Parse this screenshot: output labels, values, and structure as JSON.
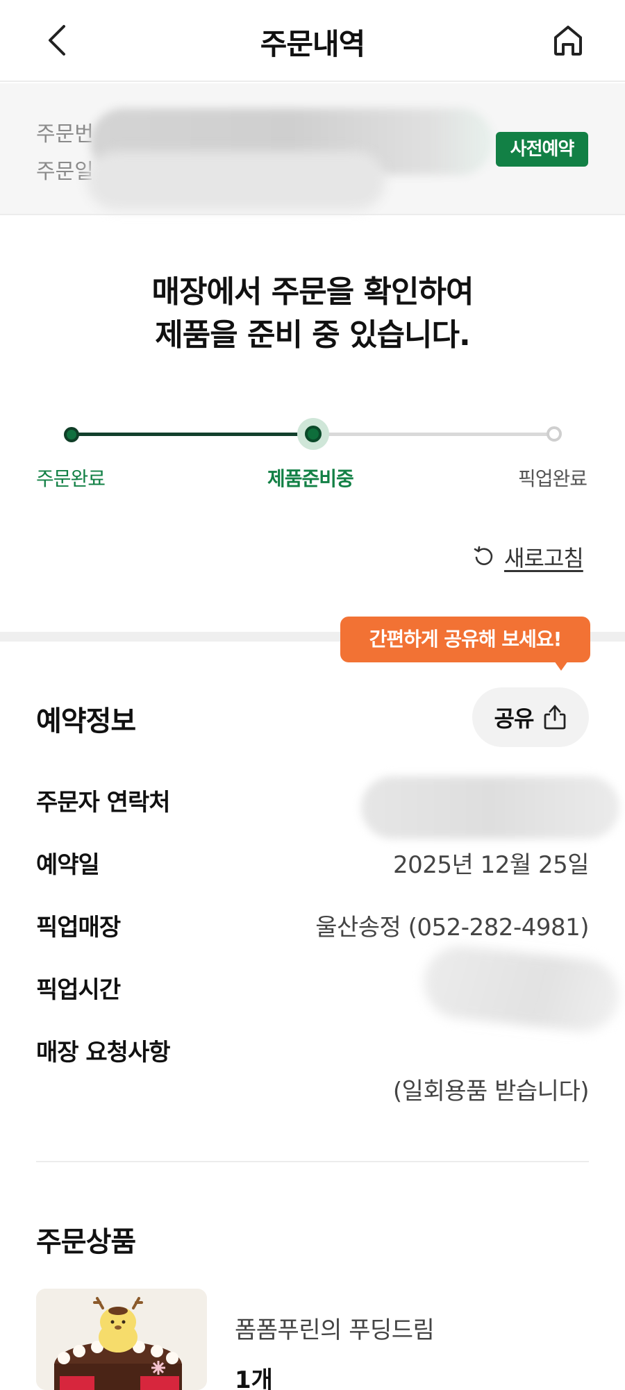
{
  "header": {
    "title": "주문내역",
    "back_icon": "chevron-left-icon",
    "home_icon": "home-icon"
  },
  "order_meta": {
    "order_number_label": "주문번",
    "order_date_label": "주문일",
    "badge": "사전예약",
    "badge_color": "#128045"
  },
  "status": {
    "message_line1": "매장에서 주문을 확인하여",
    "message_line2": "제품을 준비 중 있습니다.",
    "steps": [
      "주문완료",
      "제품준비중",
      "픽업완료"
    ],
    "current_step": 2,
    "accent_color": "#128045"
  },
  "refresh": {
    "label": "새로고침",
    "icon": "refresh-icon"
  },
  "tooltip": {
    "text": "간편하게 공유해 보세요!",
    "color": "#f27234"
  },
  "reservation": {
    "title": "예약정보",
    "share_label": "공유",
    "share_icon": "share-icon",
    "rows": [
      {
        "label": "주문자 연락처",
        "value": ""
      },
      {
        "label": "예약일",
        "value": "2025년 12월 25일"
      },
      {
        "label": "픽업매장",
        "value": "울산송정 (052-282-4981)"
      },
      {
        "label": "픽업시간",
        "value": ""
      },
      {
        "label": "매장 요청사항",
        "value": "(일회용품 받습니다)"
      }
    ]
  },
  "items": {
    "title": "주문상품",
    "list": [
      {
        "name": "폼폼푸린의 푸딩드림",
        "qty": "1개"
      }
    ]
  }
}
